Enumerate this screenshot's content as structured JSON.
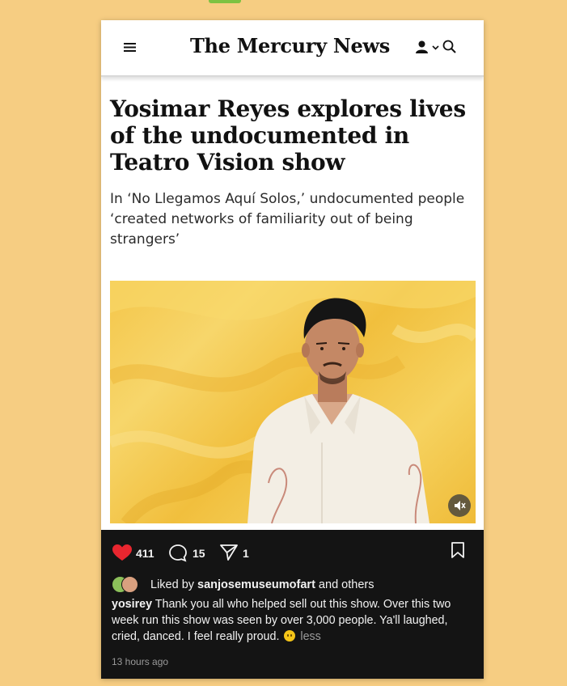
{
  "site": {
    "name": "The Mercury News"
  },
  "article": {
    "headline": "Yosimar Reyes explores lives of the undocumented in Teatro Vision show",
    "subhead": "In ‘No Llegamos Aquí Solos,’ undocumented people ‘created networks of familiarity out of being strangers’"
  },
  "post": {
    "likes": "411",
    "comments": "15",
    "shares": "1",
    "liked_prefix": "Liked by ",
    "liked_user": "sanjosemuseumofart",
    "liked_suffix": " and others",
    "author": "yosirey",
    "caption_text": "Thank you all who helped sell out this show. Over this two week run this show was seen by over 3,000 people. Ya'll laughed, cried, danced.  I feel really proud.",
    "less_label": "less",
    "time": "13 hours ago"
  },
  "icons": {
    "menu": "hamburger-menu-icon",
    "user": "user-icon",
    "search": "search-icon",
    "heart": "heart-icon",
    "comment": "comment-icon",
    "share": "share-icon",
    "bookmark": "bookmark-icon",
    "mute": "mute-icon"
  },
  "colors": {
    "background": "#f6cd82",
    "heart": "#e8262f",
    "ig_panel": "#141414",
    "photo_backdrop": "#f4c64a"
  }
}
